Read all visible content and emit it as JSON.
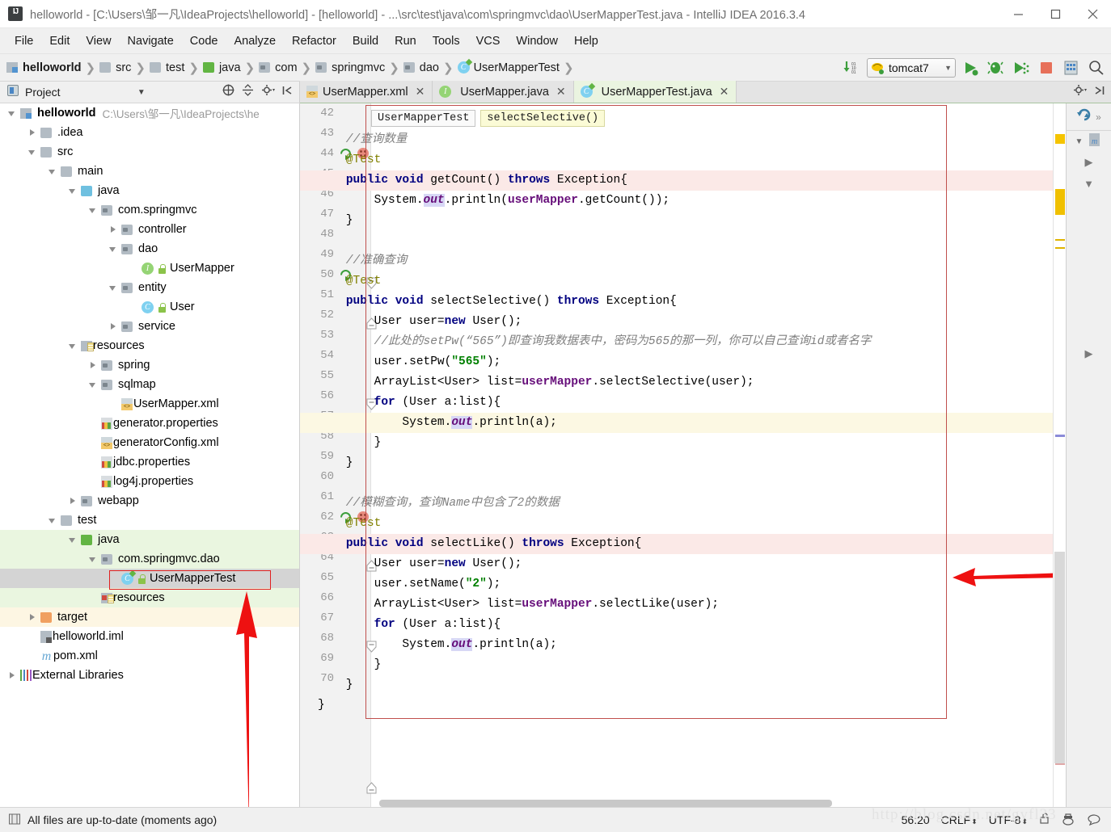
{
  "window": {
    "title": "helloworld - [C:\\Users\\邹一凡\\IdeaProjects\\helloworld] - [helloworld] - ...\\src\\test\\java\\com\\springmvc\\dao\\UserMapperTest.java - IntelliJ IDEA 2016.3.4",
    "app_icon": "intellij-idea-icon",
    "minimize": "−",
    "maximize": "□",
    "close": "✕"
  },
  "menubar": {
    "items": [
      {
        "label": "File"
      },
      {
        "label": "Edit"
      },
      {
        "label": "View"
      },
      {
        "label": "Navigate"
      },
      {
        "label": "Code"
      },
      {
        "label": "Analyze"
      },
      {
        "label": "Refactor"
      },
      {
        "label": "Build"
      },
      {
        "label": "Run"
      },
      {
        "label": "Tools"
      },
      {
        "label": "VCS"
      },
      {
        "label": "Window"
      },
      {
        "label": "Help"
      }
    ]
  },
  "navbar": {
    "breadcrumbs": [
      {
        "label": "helloworld",
        "icon": "module-icon"
      },
      {
        "label": "src",
        "icon": "folder-icon"
      },
      {
        "label": "test",
        "icon": "folder-icon"
      },
      {
        "label": "java",
        "icon": "source-root-folder-icon"
      },
      {
        "label": "com",
        "icon": "package-icon"
      },
      {
        "label": "springmvc",
        "icon": "package-icon"
      },
      {
        "label": "dao",
        "icon": "package-icon"
      },
      {
        "label": "UserMapperTest",
        "icon": "test-class-icon"
      }
    ],
    "separator": "❯",
    "run_config": {
      "label": "tomcat7",
      "icon": "tomcat-icon",
      "caret": "▾"
    },
    "actions": [
      {
        "name": "update-project-icon",
        "glyph": "⇣"
      },
      {
        "name": "run-icon",
        "glyph": "▶"
      },
      {
        "name": "debug-icon",
        "glyph": "🐞"
      },
      {
        "name": "run-with-coverage-icon",
        "glyph": "▶"
      },
      {
        "name": "stop-icon",
        "glyph": "■"
      },
      {
        "name": "project-structure-icon",
        "glyph": "▦"
      },
      {
        "name": "search-everywhere-icon",
        "glyph": "🔍"
      }
    ]
  },
  "project_panel": {
    "title": "Project",
    "title_caret": "▾",
    "actions": [
      {
        "name": "scroll-from-source-icon",
        "glyph": "⊕"
      },
      {
        "name": "collapse-all-icon",
        "glyph": "⇹"
      },
      {
        "name": "settings-gear-icon",
        "glyph": "✱"
      },
      {
        "name": "hide-panel-icon",
        "glyph": "⇥"
      }
    ],
    "tree": [
      {
        "indent": 0,
        "twist": "open",
        "icon": "module-icon",
        "label": "helloworld",
        "path": "C:\\Users\\邹一凡\\IdeaProjects\\he",
        "bold": true,
        "bg": ""
      },
      {
        "indent": 1,
        "twist": "closed",
        "icon": "folder-icon",
        "label": ".idea",
        "path": "",
        "bold": false,
        "bg": ""
      },
      {
        "indent": 1,
        "twist": "open",
        "icon": "folder-icon",
        "label": "src",
        "path": "",
        "bold": false,
        "bg": ""
      },
      {
        "indent": 2,
        "twist": "open",
        "icon": "folder-icon",
        "label": "main",
        "path": "",
        "bold": false,
        "bg": ""
      },
      {
        "indent": 3,
        "twist": "open",
        "icon": "source-root-folder-icon",
        "label": "java",
        "path": "",
        "bold": false,
        "bg": ""
      },
      {
        "indent": 4,
        "twist": "open",
        "icon": "package-icon",
        "label": "com.springmvc",
        "path": "",
        "bold": false,
        "bg": ""
      },
      {
        "indent": 5,
        "twist": "closed",
        "icon": "package-icon",
        "label": "controller",
        "path": "",
        "bold": false,
        "bg": ""
      },
      {
        "indent": 5,
        "twist": "open",
        "icon": "package-icon",
        "label": "dao",
        "path": "",
        "bold": false,
        "bg": ""
      },
      {
        "indent": 6,
        "twist": "none",
        "icon": "interface-icon",
        "label": "UserMapper",
        "path": "",
        "bold": false,
        "bg": ""
      },
      {
        "indent": 5,
        "twist": "open",
        "icon": "package-icon",
        "label": "entity",
        "path": "",
        "bold": false,
        "bg": ""
      },
      {
        "indent": 6,
        "twist": "none",
        "icon": "class-icon",
        "label": "User",
        "path": "",
        "bold": false,
        "bg": ""
      },
      {
        "indent": 5,
        "twist": "closed",
        "icon": "package-icon",
        "label": "service",
        "path": "",
        "bold": false,
        "bg": ""
      },
      {
        "indent": 3,
        "twist": "open",
        "icon": "resource-root-icon",
        "label": "resources",
        "path": "",
        "bold": false,
        "bg": ""
      },
      {
        "indent": 4,
        "twist": "closed",
        "icon": "package-icon",
        "label": "spring",
        "path": "",
        "bold": false,
        "bg": ""
      },
      {
        "indent": 4,
        "twist": "open",
        "icon": "package-icon",
        "label": "sqlmap",
        "path": "",
        "bold": false,
        "bg": ""
      },
      {
        "indent": 5,
        "twist": "none",
        "icon": "xml-icon",
        "label": "UserMapper.xml",
        "path": "",
        "bold": false,
        "bg": ""
      },
      {
        "indent": 4,
        "twist": "none",
        "icon": "properties-icon",
        "label": "generator.properties",
        "path": "",
        "bold": false,
        "bg": ""
      },
      {
        "indent": 4,
        "twist": "none",
        "icon": "xml-icon",
        "label": "generatorConfig.xml",
        "path": "",
        "bold": false,
        "bg": ""
      },
      {
        "indent": 4,
        "twist": "none",
        "icon": "properties-icon",
        "label": "jdbc.properties",
        "path": "",
        "bold": false,
        "bg": ""
      },
      {
        "indent": 4,
        "twist": "none",
        "icon": "properties-icon",
        "label": "log4j.properties",
        "path": "",
        "bold": false,
        "bg": ""
      },
      {
        "indent": 3,
        "twist": "closed",
        "icon": "webapp-folder-icon",
        "label": "webapp",
        "path": "",
        "bold": false,
        "bg": ""
      },
      {
        "indent": 2,
        "twist": "open",
        "icon": "folder-icon",
        "label": "test",
        "path": "",
        "bold": false,
        "bg": ""
      },
      {
        "indent": 3,
        "twist": "open",
        "icon": "test-source-root-folder-icon",
        "label": "java",
        "path": "",
        "bold": false,
        "bg": "test"
      },
      {
        "indent": 4,
        "twist": "open",
        "icon": "package-icon",
        "label": "com.springmvc.dao",
        "path": "",
        "bold": false,
        "bg": "test"
      },
      {
        "indent": 5,
        "twist": "none",
        "icon": "test-class-icon",
        "label": "UserMapperTest",
        "path": "",
        "bold": false,
        "bg": "sel"
      },
      {
        "indent": 4,
        "twist": "none",
        "icon": "test-resource-root-icon",
        "label": "resources",
        "path": "",
        "bold": false,
        "bg": "test"
      },
      {
        "indent": 1,
        "twist": "closed",
        "icon": "target-folder-icon",
        "label": "target",
        "path": "",
        "bold": false,
        "bg": "target"
      },
      {
        "indent": 1,
        "twist": "none",
        "icon": "iml-icon",
        "label": "helloworld.iml",
        "path": "",
        "bold": false,
        "bg": ""
      },
      {
        "indent": 1,
        "twist": "none",
        "icon": "maven-pom-icon",
        "label": "pom.xml",
        "path": "",
        "bold": false,
        "bg": ""
      },
      {
        "indent": 0,
        "twist": "closed",
        "icon": "external-libraries-icon",
        "label": "External Libraries",
        "path": "",
        "bold": false,
        "bg": ""
      }
    ]
  },
  "tabs": {
    "items": [
      {
        "label": "UserMapper.xml",
        "icon": "xml-icon",
        "active": false,
        "close": "✕"
      },
      {
        "label": "UserMapper.java",
        "icon": "interface-icon",
        "active": false,
        "close": "✕"
      },
      {
        "label": "UserMapperTest.java",
        "icon": "test-class-icon",
        "active": true,
        "close": "✕"
      }
    ],
    "actions": [
      {
        "name": "settings-gear-icon",
        "glyph": "✱"
      },
      {
        "name": "hide-panel-icon",
        "glyph": "→|"
      }
    ]
  },
  "editor": {
    "code_breadcrumbs": [
      {
        "label": "UserMapperTest",
        "current": false
      },
      {
        "label": "selectSelective()",
        "current": true
      }
    ],
    "first_line_number": 42,
    "lines": [
      {
        "n": 42,
        "text": "    //查询数量",
        "cls": "cmt",
        "hl": "",
        "gutter": ""
      },
      {
        "n": 43,
        "text": "    @Test",
        "cls": "ann",
        "hl": "",
        "gutter": ""
      },
      {
        "n": 44,
        "text": "    public void getCount() throws Exception{",
        "cls": "code",
        "hl": "method",
        "gutter": "run-test"
      },
      {
        "n": 45,
        "text": "        System.out.println(userMapper.getCount());",
        "cls": "code",
        "hl": "",
        "gutter": ""
      },
      {
        "n": 46,
        "text": "    }",
        "cls": "code",
        "hl": "",
        "gutter": ""
      },
      {
        "n": 47,
        "text": "",
        "cls": "code",
        "hl": "",
        "gutter": ""
      },
      {
        "n": 48,
        "text": "    //准确查询",
        "cls": "cmt",
        "hl": "",
        "gutter": ""
      },
      {
        "n": 49,
        "text": "    @Test",
        "cls": "ann",
        "hl": "",
        "gutter": ""
      },
      {
        "n": 50,
        "text": "    public void selectSelective() throws Exception{",
        "cls": "code",
        "hl": "",
        "gutter": "run"
      },
      {
        "n": 51,
        "text": "        User user=new User();",
        "cls": "code",
        "hl": "",
        "gutter": ""
      },
      {
        "n": 52,
        "text": "        //此处的setPw(“565”)即查询我数据表中，密码为565的那一列，你可以自己查询id或者名字",
        "cls": "cmt",
        "hl": "",
        "gutter": ""
      },
      {
        "n": 53,
        "text": "        user.setPw(\"565\");",
        "cls": "code",
        "hl": "",
        "gutter": ""
      },
      {
        "n": 54,
        "text": "        ArrayList<User> list=userMapper.selectSelective(user);",
        "cls": "code",
        "hl": "",
        "gutter": ""
      },
      {
        "n": 55,
        "text": "        for (User a:list){",
        "cls": "code",
        "hl": "",
        "gutter": ""
      },
      {
        "n": 56,
        "text": "            System.out.println(a);",
        "cls": "code",
        "hl": "caret",
        "gutter": ""
      },
      {
        "n": 57,
        "text": "        }",
        "cls": "code",
        "hl": "",
        "gutter": ""
      },
      {
        "n": 58,
        "text": "    }",
        "cls": "code",
        "hl": "",
        "gutter": ""
      },
      {
        "n": 59,
        "text": "",
        "cls": "code",
        "hl": "",
        "gutter": ""
      },
      {
        "n": 60,
        "text": "    //模糊查询，查询Name中包含了2的数据",
        "cls": "cmt",
        "hl": "",
        "gutter": ""
      },
      {
        "n": 61,
        "text": "    @Test",
        "cls": "ann",
        "hl": "",
        "gutter": ""
      },
      {
        "n": 62,
        "text": "    public void selectLike() throws Exception{",
        "cls": "code",
        "hl": "method",
        "gutter": "run-test"
      },
      {
        "n": 63,
        "text": "        User user=new User();",
        "cls": "code",
        "hl": "",
        "gutter": ""
      },
      {
        "n": 64,
        "text": "        user.setName(\"2\");",
        "cls": "code",
        "hl": "",
        "gutter": ""
      },
      {
        "n": 65,
        "text": "        ArrayList<User> list=userMapper.selectLike(user);",
        "cls": "code",
        "hl": "",
        "gutter": ""
      },
      {
        "n": 66,
        "text": "        for (User a:list){",
        "cls": "code",
        "hl": "",
        "gutter": ""
      },
      {
        "n": 67,
        "text": "            System.out.println(a);",
        "cls": "code",
        "hl": "",
        "gutter": ""
      },
      {
        "n": 68,
        "text": "        }",
        "cls": "code",
        "hl": "",
        "gutter": ""
      },
      {
        "n": 69,
        "text": "    }",
        "cls": "code",
        "hl": "",
        "gutter": ""
      },
      {
        "n": 70,
        "text": "}",
        "cls": "code",
        "hl": "",
        "gutter": ""
      }
    ]
  },
  "right_strip": {
    "items": [
      {
        "name": "refresh-icon",
        "glyph": "↻"
      },
      {
        "name": "expand-strip-icon",
        "glyph": "»"
      },
      {
        "name": "collapse-icon",
        "glyph": "▾"
      },
      {
        "name": "maven-projects-icon",
        "glyph": "m"
      },
      {
        "name": "ant-build-tab",
        "glyph": "▶"
      },
      {
        "name": "maven-projects-tab",
        "glyph": "▼"
      },
      {
        "name": "database-tab",
        "glyph": "▶"
      }
    ]
  },
  "statusbar": {
    "message": "All files are up-to-date (moments ago)",
    "message_icon": "vcs-icon",
    "caret_position": "56:20",
    "line_separator": "CRLF",
    "encoding": "UTF-8",
    "stepper": "⬍",
    "lock_icon": "unlocked-icon",
    "inspection_icon": "hector-icon",
    "event_log_icon": "event-log-icon"
  },
  "annotations": {
    "watermark": "http://blog.csdn.net/gyfl33",
    "arrow_color": "#ee1111",
    "highlight_box_color": "#e02020"
  },
  "colors": {
    "accent_green": "#62b543",
    "keyword": "#000080",
    "string": "#008000",
    "comment": "#808080",
    "annotation": "#808000",
    "field": "#660e7a",
    "method_highlight": "#fbe9e7",
    "caret_line": "#fcf8e3",
    "selection": "#d4d4d4"
  }
}
